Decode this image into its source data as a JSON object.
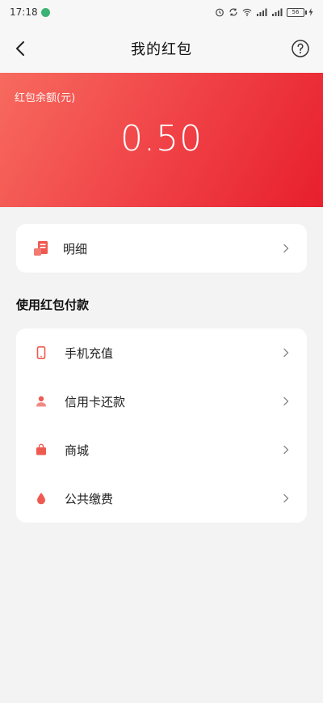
{
  "status_bar": {
    "time": "17:18",
    "battery": "56"
  },
  "nav": {
    "title": "我的红包"
  },
  "balance": {
    "label": "红包余额(元)",
    "amount": "0.50"
  },
  "detail": {
    "label": "明细"
  },
  "pay_section": {
    "title": "使用红包付款",
    "items": [
      {
        "label": "手机充值",
        "icon": "phone-icon"
      },
      {
        "label": "信用卡还款",
        "icon": "person-icon"
      },
      {
        "label": "商城",
        "icon": "bag-icon"
      },
      {
        "label": "公共缴费",
        "icon": "drop-icon"
      }
    ]
  },
  "colors": {
    "accent": "#e71f2c",
    "accent_light": "#f76a5e",
    "icon_red": "#ef5a50",
    "background": "#f3f3f3"
  }
}
